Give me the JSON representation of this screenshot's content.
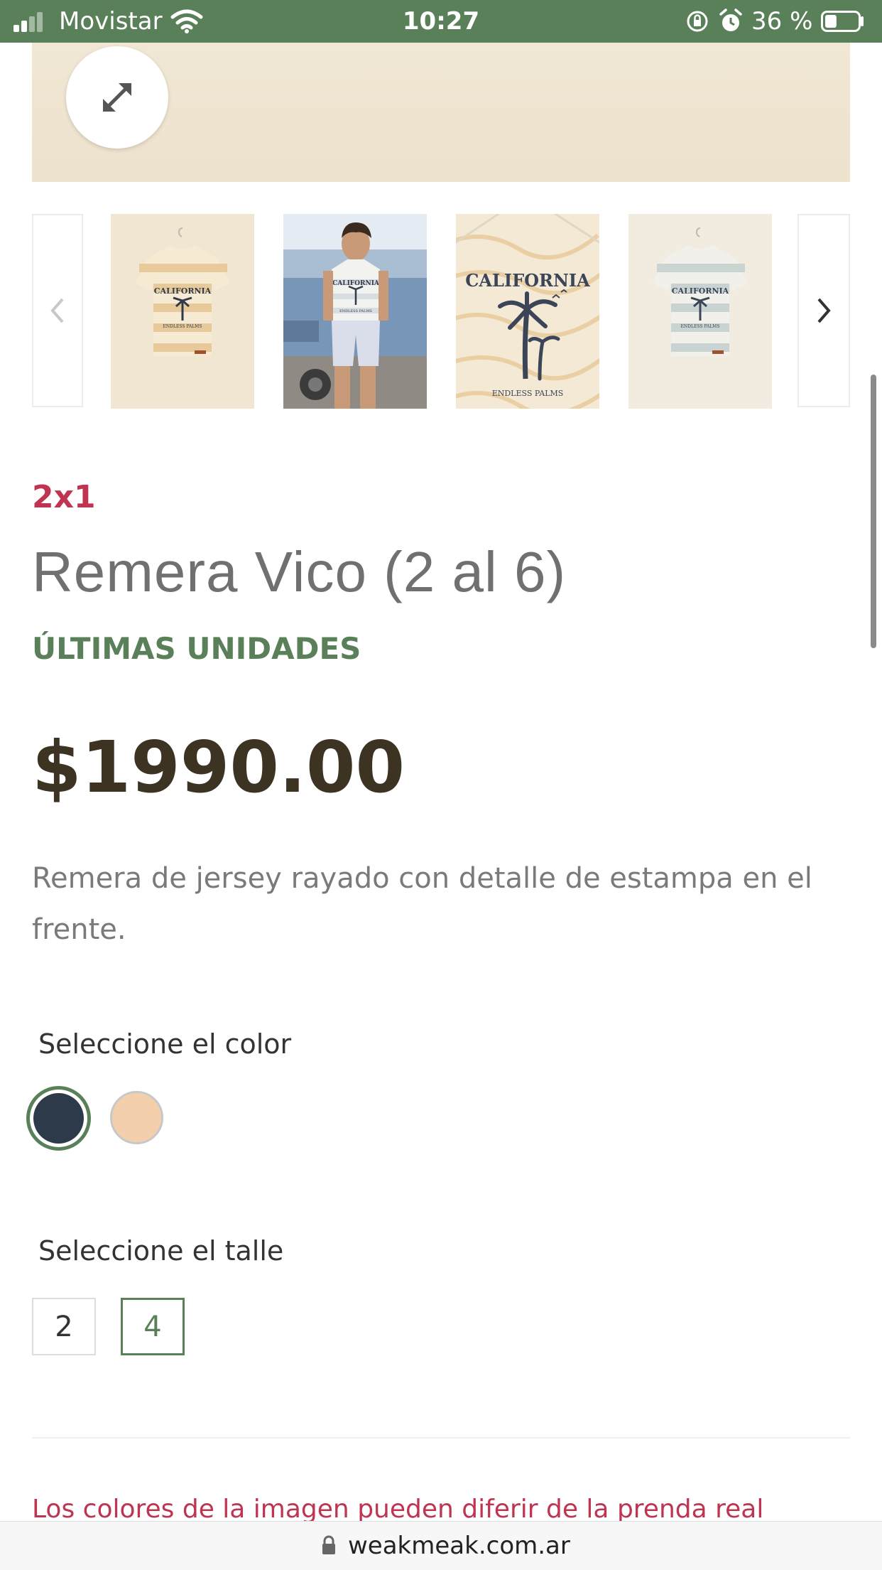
{
  "status_bar": {
    "carrier": "Movistar",
    "time": "10:27",
    "battery_percent": "36 %",
    "battery_level": 0.36,
    "icons": [
      "signal-icon",
      "wifi-icon",
      "rotation-lock-icon",
      "alarm-icon",
      "battery-icon"
    ]
  },
  "gallery": {
    "expand_icon": "expand-arrows-icon",
    "prev_icon": "chevron-left-icon",
    "next_icon": "chevron-right-icon",
    "thumbnails": [
      {
        "name": "thumb-orange-stripes",
        "print_top": "CALIFORNIA",
        "print_bottom": "ENDLESS PALMS"
      },
      {
        "name": "thumb-model-photo",
        "print_top": "CALIFORNIA",
        "print_bottom": "ENDLESS PALMS"
      },
      {
        "name": "thumb-print-closeup",
        "print_top": "CALIFORNIA",
        "print_bottom": "ENDLESS PALMS"
      },
      {
        "name": "thumb-blue-stripes",
        "print_top": "CALIFORNIA",
        "print_bottom": "ENDLESS PALMS"
      }
    ]
  },
  "product": {
    "promo": "2x1",
    "title": "Remera Vico (2 al 6)",
    "stock_status": "ÚLTIMAS UNIDADES",
    "price": "$1990.00",
    "description": "Remera de jersey rayado con detalle de estampa en el frente."
  },
  "color_selector": {
    "label": "Seleccione el color",
    "options": [
      {
        "name": "navy",
        "hex": "#2c3a4a",
        "selected": true
      },
      {
        "name": "peach",
        "hex": "#f4cfac",
        "selected": false
      }
    ]
  },
  "size_selector": {
    "label": "Seleccione el talle",
    "options": [
      {
        "label": "2",
        "selected": false
      },
      {
        "label": "4",
        "selected": true
      }
    ]
  },
  "disclaimer": "Los colores de la imagen pueden diferir de la prenda real",
  "url_bar": {
    "url": "weakmeak.com.ar"
  },
  "colors": {
    "brand_green": "#5a8059",
    "promo_red": "#bf3450",
    "price_brown": "#3d3322"
  }
}
